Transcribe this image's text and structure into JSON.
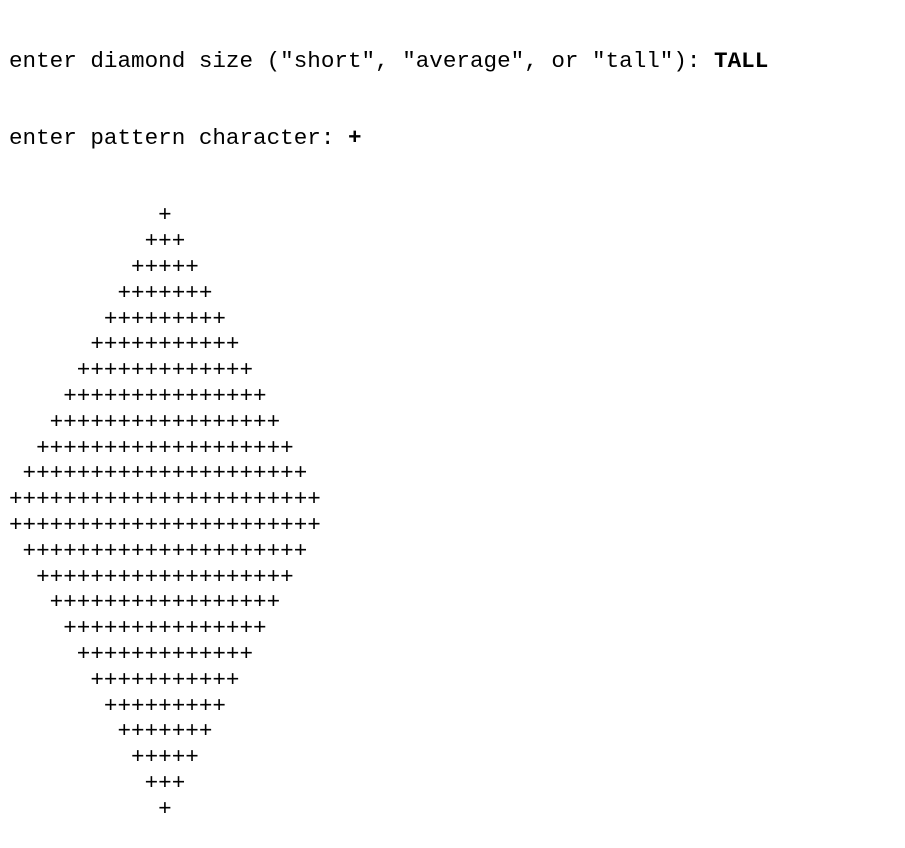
{
  "prompts": [
    {
      "text": "enter diamond size (\"short\", \"average\", or \"tall\"): ",
      "input": "TALL"
    },
    {
      "text": "enter pattern character: ",
      "input": "+"
    }
  ],
  "diamond": {
    "character": "+",
    "max_width": 23,
    "row_counts": [
      1,
      3,
      5,
      7,
      9,
      11,
      13,
      15,
      17,
      19,
      21,
      23,
      23,
      21,
      19,
      17,
      15,
      13,
      11,
      9,
      7,
      5,
      3,
      1
    ]
  },
  "colors": {
    "text": "#000000",
    "background": "#ffffff"
  }
}
